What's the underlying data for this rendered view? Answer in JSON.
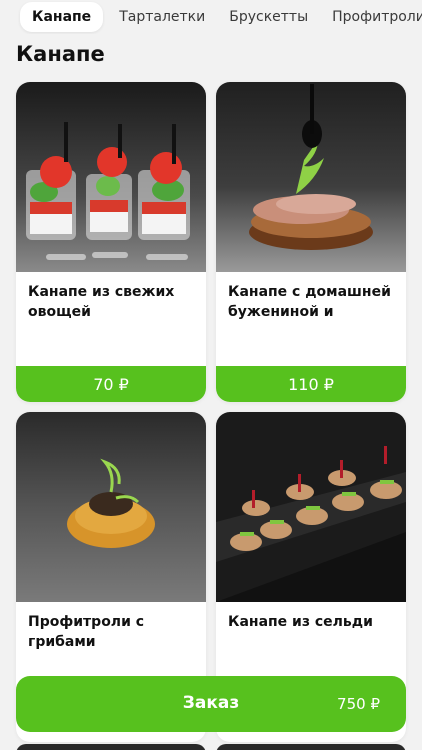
{
  "tabs": [
    "Канапе",
    "Тарталетки",
    "Брускетты",
    "Профитроли"
  ],
  "section": {
    "title": "Канапе"
  },
  "products": [
    {
      "name": "Канапе из свежих овощей",
      "price": "70 ₽"
    },
    {
      "name": "Канапе с домашней бужениной и",
      "price": "110 ₽"
    },
    {
      "name": "Профитроли с грибами",
      "price": ""
    },
    {
      "name": "Канапе из сельди",
      "price": ""
    }
  ],
  "order": {
    "label": "Заказ",
    "total": "750 ₽"
  },
  "colors": {
    "accent": "#57c11e",
    "background": "#f2f2f2",
    "card": "#ffffff"
  }
}
